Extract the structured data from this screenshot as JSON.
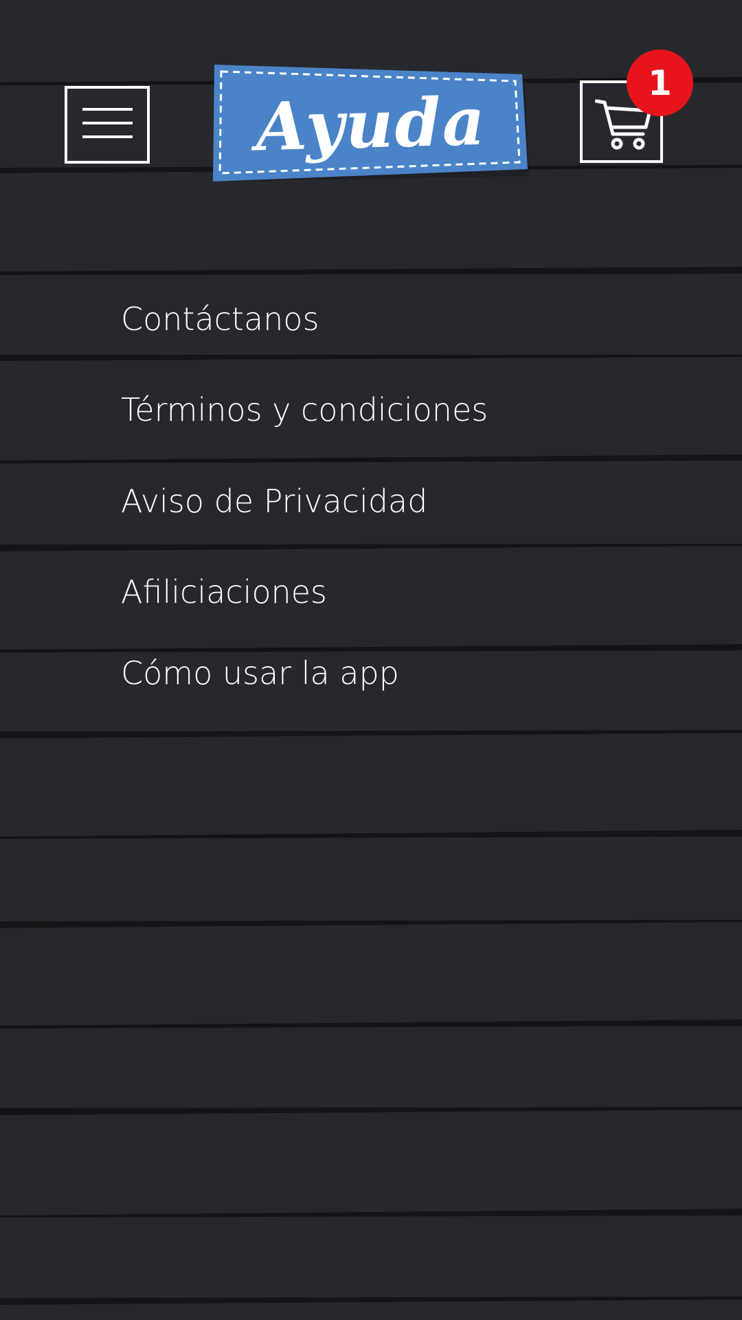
{
  "header": {
    "menu_icon": "hamburger-menu-icon",
    "title": "Ayuda",
    "cart_icon": "shopping-cart-icon",
    "cart_badge_count": "1",
    "colors": {
      "title_tag_blue": "#4a83c7",
      "badge_red": "#e8141c",
      "background": "#27282d",
      "line_dark": "#141416"
    }
  },
  "help_menu": {
    "items": [
      {
        "label": "Contáctanos"
      },
      {
        "label": "Términos y condiciones"
      },
      {
        "label": "Aviso de Privacidad"
      },
      {
        "label": "Afiliciaciones"
      },
      {
        "label": "Cómo usar la app"
      }
    ]
  }
}
